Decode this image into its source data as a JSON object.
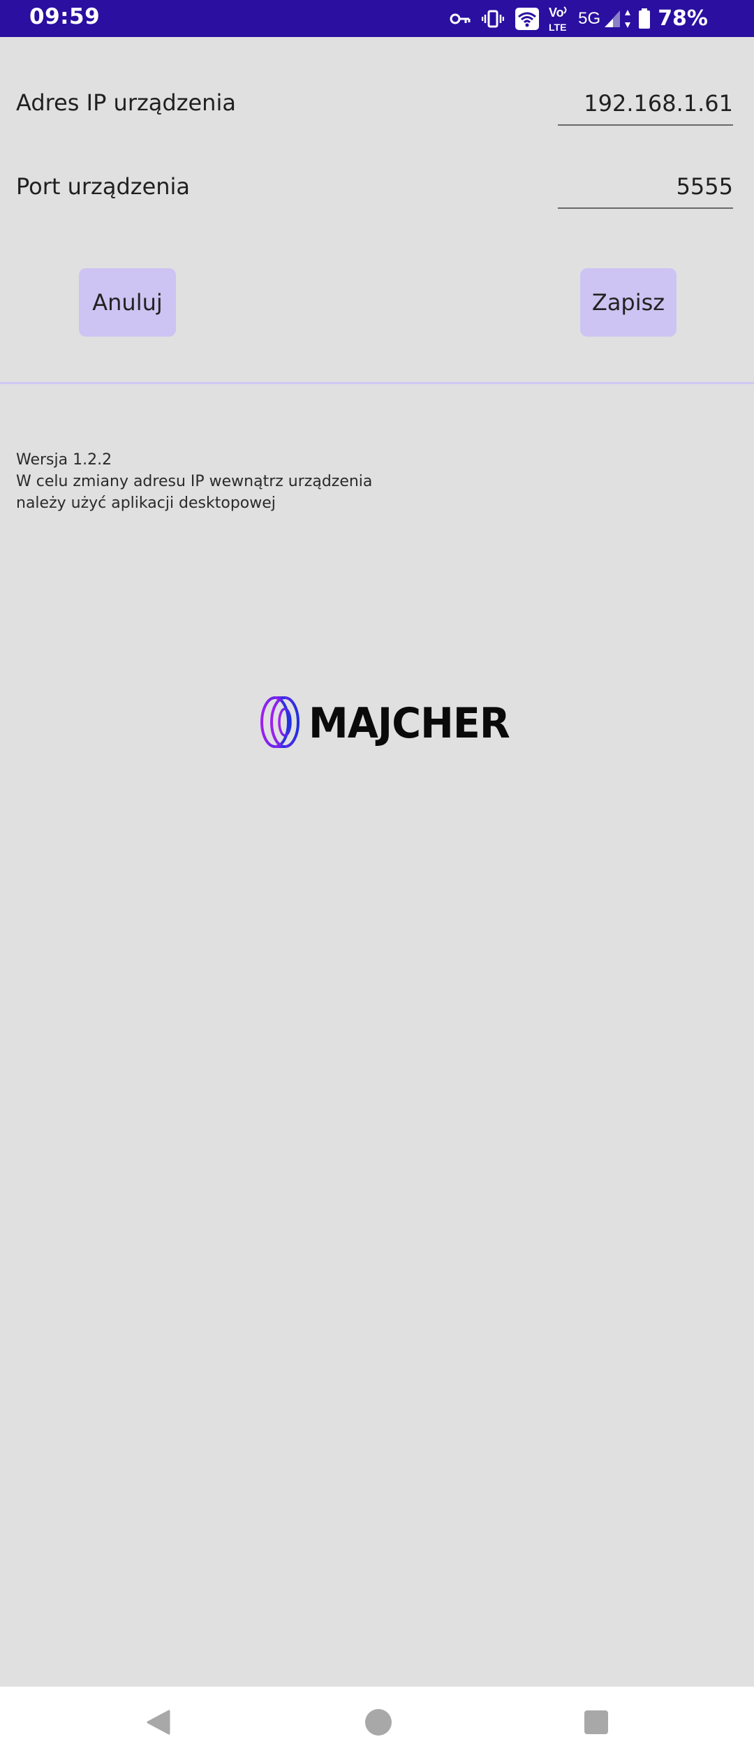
{
  "status_bar": {
    "time": "09:59",
    "network_5g": "5G",
    "battery_percent": "78%",
    "background_color": "#2a0fa0",
    "icons": [
      "vpn-key-icon",
      "vibrate-icon",
      "wifi-icon",
      "volte-icon",
      "signal-icon",
      "data-arrows-icon",
      "battery-icon"
    ]
  },
  "form": {
    "ip": {
      "label": "Adres IP urządzenia",
      "value": "192.168.1.61"
    },
    "port": {
      "label": "Port urządzenia",
      "value": "5555"
    }
  },
  "buttons": {
    "cancel_label": "Anuluj",
    "save_label": "Zapisz",
    "color": "#cdc4f3"
  },
  "info": {
    "version": "Wersja 1.2.2",
    "line1": "W celu zmiany adresu IP wewnątrz urządzenia",
    "line2": "należy użyć aplikacji desktopowej"
  },
  "logo": {
    "text": "MAJCHER",
    "icon": "tire-icon",
    "gradient_colors": [
      "#a020f0",
      "#2030e0"
    ]
  },
  "nav_bar": {
    "icons": [
      "back-icon",
      "home-icon",
      "recents-icon"
    ]
  }
}
